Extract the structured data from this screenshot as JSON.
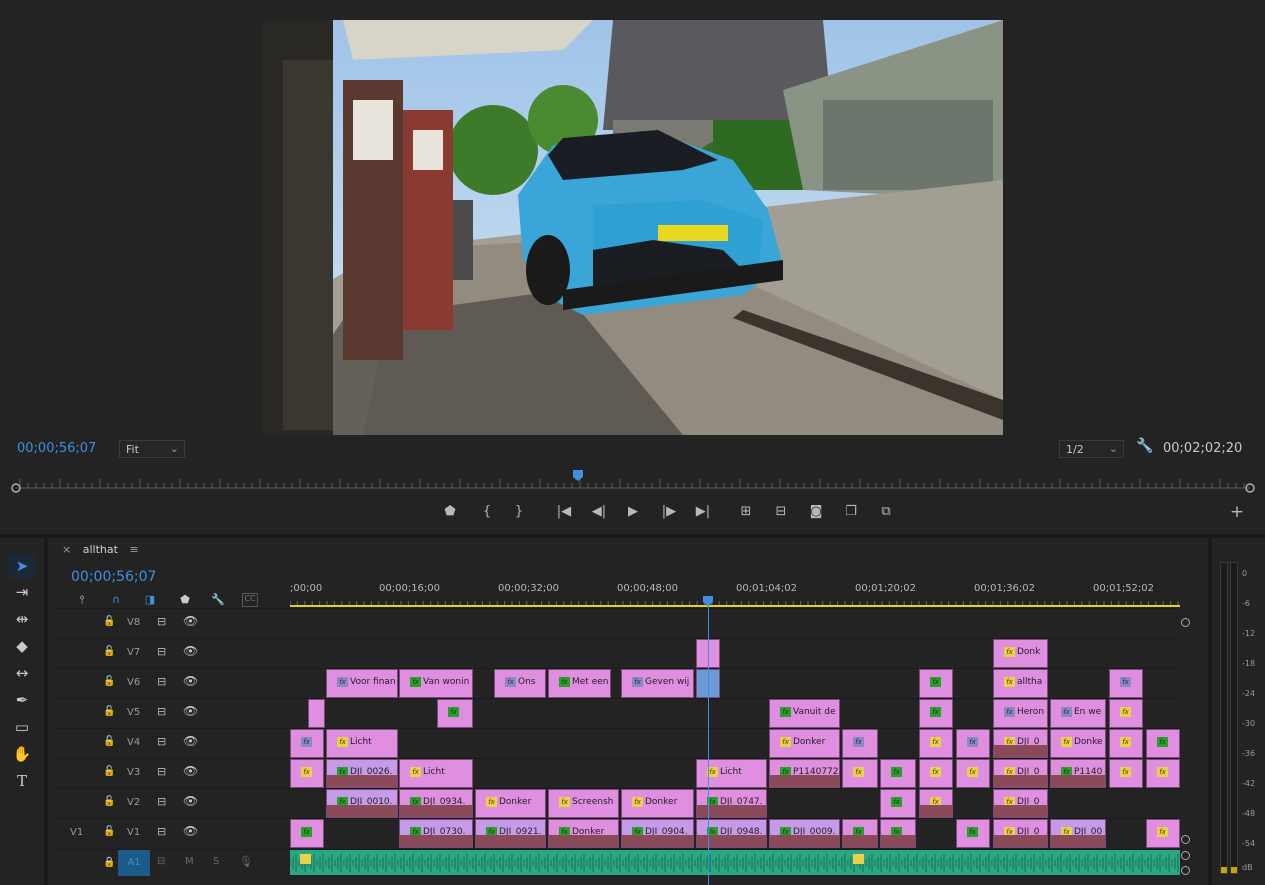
{
  "monitor": {
    "current_timecode": "00;00;56;07",
    "zoom": "Fit",
    "resolution": "1/2",
    "duration": "00;02;02;20"
  },
  "transport": {
    "icons": [
      "marker-icon",
      "mark-in-icon",
      "mark-out-icon",
      "go-to-in-icon",
      "step-back-icon",
      "play-icon",
      "step-forward-icon",
      "go-to-out-icon",
      "lift-icon",
      "extract-icon",
      "export-frame-icon",
      "comparison-view-icon",
      "trim-icon"
    ],
    "add_button": "+"
  },
  "tools": [
    "selection-tool",
    "track-select-tool",
    "ripple-edit-tool",
    "razor-tool",
    "slip-tool",
    "pen-tool",
    "rectangle-tool",
    "hand-tool",
    "type-tool"
  ],
  "timeline": {
    "tab_label": "allthat",
    "timecode": "00;00;56;07",
    "cc_label": "CC",
    "ruler": [
      ";00;00",
      "00;00;16;00",
      "00;00;32;00",
      "00;00;48;00",
      "00;01;04;02",
      "00;01;20;02",
      "00;01;36;02",
      "00;01;52;02"
    ],
    "tracks": [
      {
        "name": "V8",
        "src": ""
      },
      {
        "name": "V7",
        "src": ""
      },
      {
        "name": "V6",
        "src": ""
      },
      {
        "name": "V5",
        "src": ""
      },
      {
        "name": "V4",
        "src": ""
      },
      {
        "name": "V3",
        "src": ""
      },
      {
        "name": "V2",
        "src": ""
      },
      {
        "name": "V1",
        "src": "V1"
      }
    ],
    "audio_track": {
      "name": "A1",
      "m": "M",
      "s": "S"
    },
    "clip_labels": {
      "v7": [
        "Donk"
      ],
      "v6": [
        "Voor finan",
        "Van wonin",
        "Ons",
        "Met een",
        "Geven wij",
        "alltha"
      ],
      "v5": [
        "Vanuit de",
        "Heron",
        "En we"
      ],
      "v4": [
        "Licht",
        "Donker",
        "DJI_0",
        "Donke"
      ],
      "v3": [
        "DJI_0026.",
        "Licht",
        "Licht",
        "P1140772",
        "DJI_0",
        "P1140"
      ],
      "v2": [
        "DJI_0010.",
        "DJI_0934.",
        "Donker",
        "Screensh",
        "Donker",
        "DJI_0747.",
        "DJI_0"
      ],
      "v1": [
        "DJI_0730.",
        "DJI_0921.",
        "Donker",
        "DJI_0904.",
        "DJI_0948.",
        "DJI_0009.",
        "DJI_0",
        "DJI_00"
      ]
    }
  },
  "meters": {
    "scale": [
      "0",
      "-6",
      "-12",
      "-18",
      "-24",
      "-30",
      "-36",
      "-42",
      "-48",
      "-54",
      "dB"
    ]
  },
  "colors": {
    "accent": "#3d8fe0",
    "clip": "#e08fe0",
    "audio": "#2aa884"
  }
}
